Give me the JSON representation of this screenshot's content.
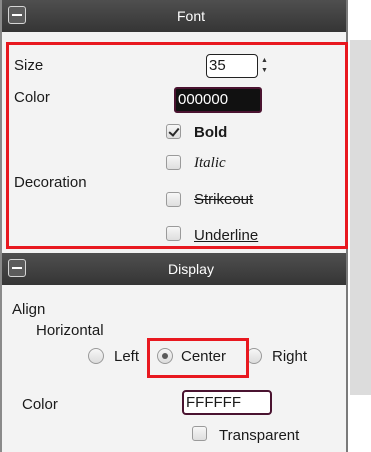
{
  "font_section": {
    "title": "Font",
    "size_label": "Size",
    "size_value": "35",
    "color_label": "Color",
    "color_value": "000000",
    "decoration_label": "Decoration",
    "bold_label": "Bold",
    "bold_checked": true,
    "italic_label": "Italic",
    "italic_checked": false,
    "strikeout_label": "Strikeout",
    "strikeout_checked": false,
    "underline_label": "Underline",
    "underline_checked": false
  },
  "display_section": {
    "title": "Display",
    "align_label": "Align",
    "horizontal_label": "Horizontal",
    "options": [
      "Left",
      "Center",
      "Right"
    ],
    "selected_option": "Center",
    "color_label": "Color",
    "color_value": "FFFFFF",
    "transparent_label": "Transparent",
    "transparent_checked": false
  },
  "colors": {
    "highlight": "#e8181f",
    "header": "#3f3f3f"
  }
}
